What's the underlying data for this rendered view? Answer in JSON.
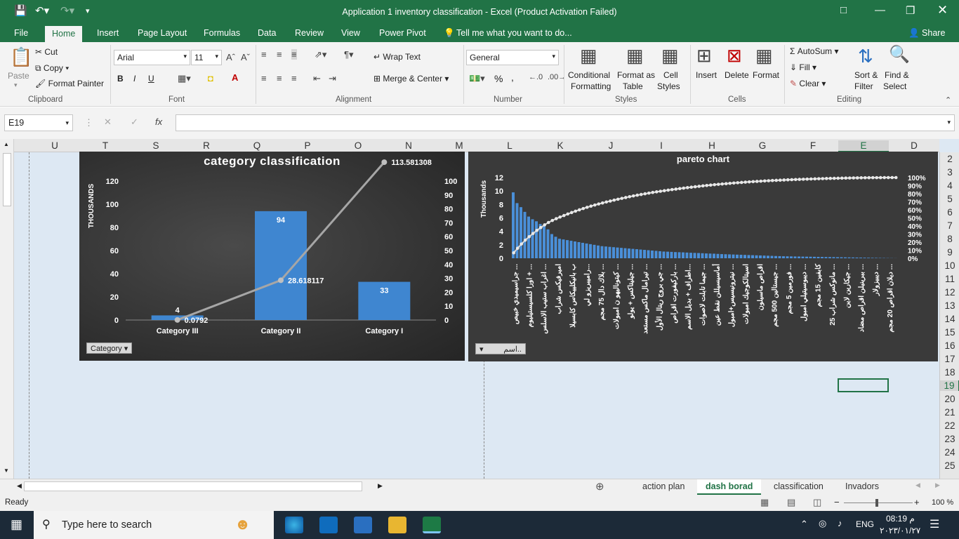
{
  "window": {
    "title": "Application 1 inventory classification - Excel (Product Activation Failed)"
  },
  "ribbon_tabs": [
    "File",
    "Home",
    "Insert",
    "Page Layout",
    "Formulas",
    "Data",
    "Review",
    "View",
    "Power Pivot"
  ],
  "tell_me": "Tell me what you want to do...",
  "share": "Share",
  "clipboard": {
    "paste": "Paste",
    "cut": "Cut",
    "copy": "Copy",
    "format_painter": "Format Painter",
    "label": "Clipboard"
  },
  "font": {
    "name": "Arial",
    "size": "11",
    "label": "Font",
    "bold": "B",
    "italic": "I",
    "underline": "U"
  },
  "alignment": {
    "wrap": "Wrap Text",
    "merge": "Merge & Center",
    "label": "Alignment"
  },
  "number": {
    "format": "General",
    "percent": "%",
    "comma": ",",
    "label": "Number"
  },
  "styles": {
    "conditional": "Conditional",
    "conditional2": "Formatting",
    "format_table": "Format as",
    "format_table2": "Table",
    "cell_styles": "Cell",
    "cell_styles2": "Styles",
    "label": "Styles"
  },
  "cells": {
    "insert": "Insert",
    "delete": "Delete",
    "format": "Format",
    "label": "Cells"
  },
  "editing": {
    "autosum": "AutoSum",
    "fill": "Fill",
    "clear": "Clear",
    "sort": "Sort &",
    "sort2": "Filter",
    "find": "Find &",
    "find2": "Select",
    "label": "Editing"
  },
  "formula_bar": {
    "name_box": "E19",
    "fx": "fx",
    "value": ""
  },
  "columns": [
    "U",
    "T",
    "S",
    "R",
    "Q",
    "P",
    "O",
    "N",
    "M",
    "L",
    "K",
    "J",
    "I",
    "H",
    "G",
    "F",
    "E",
    "D"
  ],
  "rows": [
    "2",
    "3",
    "4",
    "5",
    "6",
    "7",
    "8",
    "9",
    "10",
    "11",
    "12",
    "13",
    "14",
    "15",
    "16",
    "17",
    "18",
    "19",
    "20",
    "21",
    "22",
    "23",
    "24",
    "25"
  ],
  "chart1": {
    "title": "category classification",
    "ylabel": "THOUSANDS",
    "slicer": "Category",
    "left_ticks": [
      "0",
      "20",
      "40",
      "60",
      "80",
      "100",
      "120"
    ],
    "right_ticks": [
      "0",
      "10",
      "20",
      "30",
      "40",
      "50",
      "60",
      "70",
      "80",
      "90",
      "100"
    ],
    "categories": [
      "Category III",
      "Category II",
      "Category I"
    ],
    "bar_labels": [
      "4",
      "94",
      "33"
    ],
    "line_labels": [
      "0.0792",
      "28.618117",
      "113.581308"
    ]
  },
  "chart2": {
    "title": "pareto chart",
    "ylabel": "Thousands",
    "slicer": "اسم..",
    "left_ticks": [
      "0",
      "2",
      "4",
      "6",
      "8",
      "10",
      "12"
    ],
    "right_ticks": [
      "0%",
      "10%",
      "20%",
      "30%",
      "40%",
      "50%",
      "60%",
      "70%",
      "80%",
      "90%",
      "100%"
    ],
    "x_labels": [
      "جراسيميدي خبيص ...",
      "اورا كلسيستيليوم + ...",
      "اغراب ستيب الاسلس ...",
      "اميرفيكس شراب",
      "ب بانيكلييكاس كابسيلا",
      "راميبريزو لي...",
      "بلاك دال 75 مجم ...",
      "كيتوناليهو ن امبولات ...",
      "جيليتاكس + يولو ...",
      "تيرامال ماكس مستعد ...",
      "جي بروج ريتال الأول ...",
      "باركيفورت اقراص ...",
      "اطراف + بديل الاسم...",
      "جيما تابلت لاصوات ...",
      "أماسيسيللن نقط عين",
      "نيترونيسيس+امبول ...",
      "اسيتالكوجيك امبولات",
      "اقراص ماسيلون",
      "جيستالين 500 مجم ...",
      "فورمين 5 مجم ...",
      "ديبوسيتيلي امبول ...",
      "كابفين 15 مجم",
      "مانوكس شراب 25 ...",
      "جيكارين لاين ...",
      "ببرينيلن اقراص مضاد ...",
      "ديبيزولار ...",
      "ديلان اقراص 20 مجم ..."
    ],
    "pareto_end": "100%"
  },
  "chart1_data": {
    "type": "bar",
    "categories": [
      "Category III",
      "Category II",
      "Category I"
    ],
    "series": [
      {
        "name": "value",
        "values": [
          4,
          94,
          33
        ],
        "axis": "left",
        "unit": "thousands"
      },
      {
        "name": "cumulative",
        "values": [
          0.0792,
          28.618117,
          113.581308
        ],
        "axis": "right",
        "type": "line"
      }
    ],
    "ylabel": "THOUSANDS",
    "ylim": [
      0,
      120
    ],
    "y2lim": [
      0,
      100
    ]
  },
  "chart_data": [
    {
      "type": "bar",
      "title": "category classification",
      "categories": [
        "Category III",
        "Category II",
        "Category I"
      ],
      "values": [
        4,
        94,
        33
      ],
      "line_values": [
        0.0792,
        28.618117,
        113.581308
      ],
      "ylabel": "THOUSANDS",
      "ylim": [
        0,
        120
      ],
      "y2lim": [
        0,
        100
      ]
    },
    {
      "type": "bar",
      "title": "pareto chart",
      "ylabel": "Thousands",
      "ylim": [
        0,
        12
      ],
      "y2lim": [
        0,
        1
      ],
      "values": [
        9.8,
        8.2,
        7.6,
        6.9,
        6.2,
        5.8,
        5.5,
        5.1,
        4.8,
        4.3,
        3.6,
        3.2,
        2.9,
        2.8,
        2.7,
        2.6,
        2.5,
        2.4,
        2.3,
        2.2,
        2.1,
        2.0,
        1.9,
        1.8,
        1.75,
        1.7,
        1.65,
        1.6,
        1.55,
        1.5,
        1.45,
        1.4,
        1.35,
        1.3,
        1.25,
        1.2,
        1.15,
        1.1,
        1.05,
        1.0,
        0.98,
        0.95,
        0.92,
        0.9,
        0.88,
        0.85,
        0.82,
        0.8,
        0.78,
        0.75,
        0.72,
        0.7,
        0.68,
        0.65,
        0.62,
        0.6,
        0.58,
        0.56,
        0.54,
        0.52,
        0.5,
        0.48,
        0.46,
        0.44,
        0.42,
        0.4,
        0.38,
        0.36,
        0.34,
        0.32,
        0.3,
        0.29,
        0.28,
        0.27,
        0.26,
        0.25,
        0.24,
        0.23,
        0.22,
        0.21,
        0.2,
        0.19,
        0.18,
        0.17,
        0.16,
        0.15,
        0.14,
        0.13,
        0.12,
        0.11,
        0.1,
        0.09,
        0.08,
        0.07,
        0.06,
        0.05,
        0.04,
        0.03,
        0.02,
        0.01
      ]
    }
  ],
  "sheets": [
    "action plan",
    "dash borad",
    "classification",
    "Invadors"
  ],
  "active_sheet": "dash borad",
  "status": {
    "ready": "Ready",
    "zoom": "100 %"
  },
  "taskbar": {
    "search": "Type here to search",
    "lang": "ENG",
    "time": "08:19 م",
    "date": "٢٠٢٣/٠١/٢٧"
  }
}
